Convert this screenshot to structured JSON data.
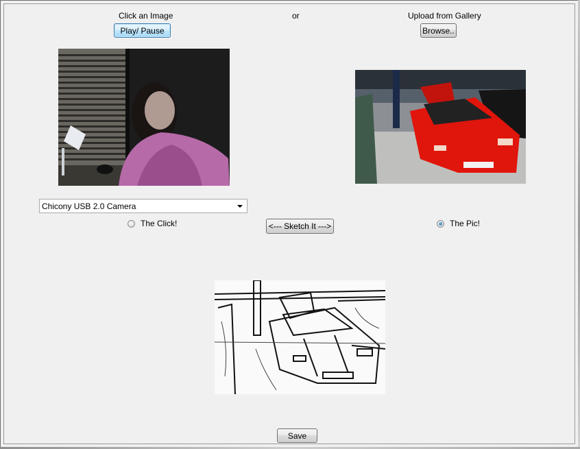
{
  "webcam_section": {
    "heading": "Click an Image",
    "play_pause_label": "Play/ Pause"
  },
  "or_label": "or",
  "gallery_section": {
    "heading": "Upload from Gallery",
    "browse_label": "Browse.."
  },
  "camera_select": {
    "selected": "Chicony USB 2.0 Camera"
  },
  "radio_options": {
    "click": {
      "label": "The Click!",
      "checked": false
    },
    "pic": {
      "label": "The Pic!",
      "checked": true
    }
  },
  "sketch_button_label": "<---  Sketch It --->",
  "save_label": "Save",
  "icons": [
    "chevron-down-icon",
    "radio-icon"
  ],
  "colors": {
    "window_bg": "#f0f0f0",
    "focus_border": "#3c7fb1",
    "car_red": "#e0150c"
  }
}
